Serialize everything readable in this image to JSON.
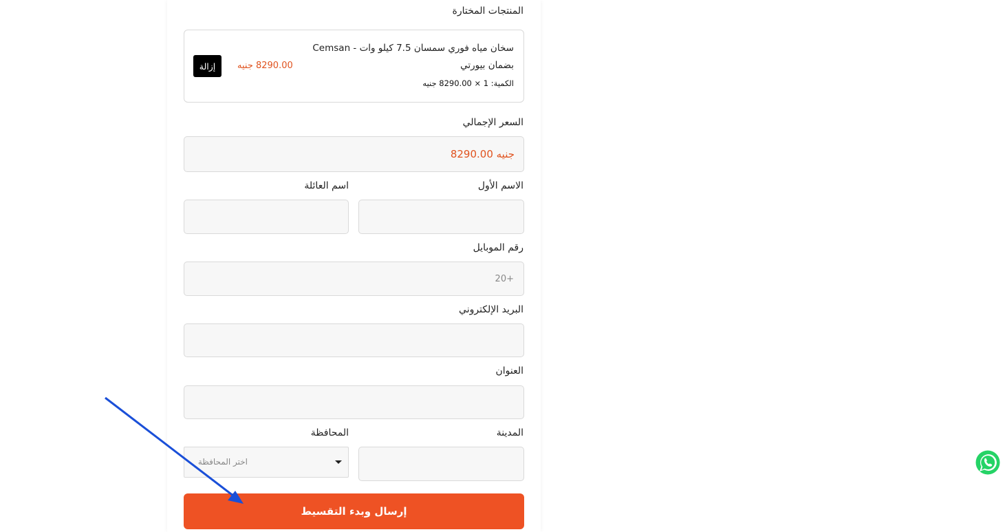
{
  "selected_products_label": "المنتجات المختارة",
  "product": {
    "name": "سخان مياه فوري سمسان 7.5 كيلو وات - Cemsan بضمان بيورتي",
    "quantity_line": "الكمية: 1 × 8290.00 جنيه",
    "price": "8290.00 جنيه",
    "remove_label": "إزالة"
  },
  "total": {
    "label": "السعر الإجمالي",
    "value": "جنيه 8290.00"
  },
  "form": {
    "first_name_label": "الاسم الأول",
    "first_name_value": "",
    "last_name_label": "اسم العائلة",
    "last_name_value": "",
    "mobile_label": "رقم الموبايل",
    "mobile_placeholder": "+20",
    "email_label": "البريد الإلكتروني",
    "email_value": "",
    "address_label": "العنوان",
    "address_value": "",
    "city_label": "المدينة",
    "city_value": "",
    "governorate_label": "المحافظة",
    "governorate_selected": "اختر المحافظة"
  },
  "submit_label": "إرسال وبدء التقسيط",
  "colors": {
    "accent": "#ee5224",
    "price": "#e0531f",
    "whatsapp": "#25d366",
    "annotation_arrow": "#1a4fd8"
  },
  "icons": {
    "whatsapp": "whatsapp-icon",
    "select_caret": "caret-down-icon"
  }
}
